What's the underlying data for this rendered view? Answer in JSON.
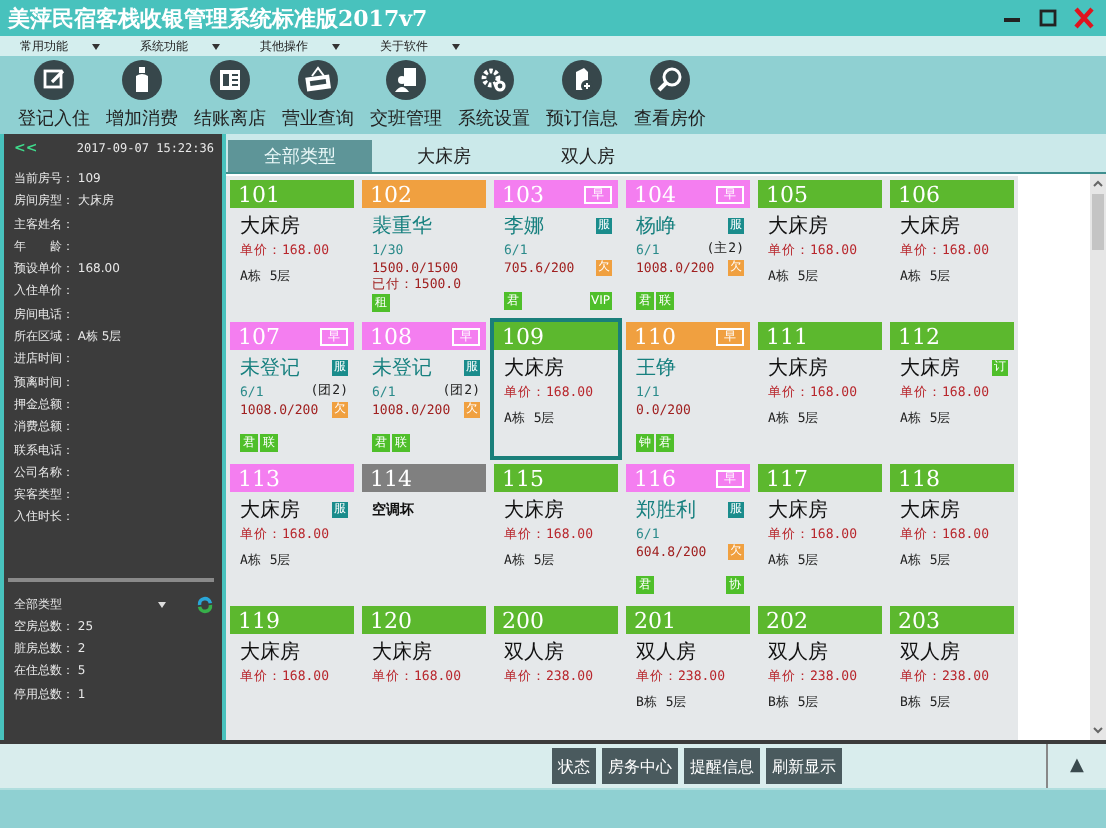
{
  "window": {
    "title": "美萍民宿客栈收银管理系统标准版2017v7"
  },
  "menu": [
    {
      "label": "常用功能"
    },
    {
      "label": "系统功能"
    },
    {
      "label": "其他操作"
    },
    {
      "label": "关于软件"
    }
  ],
  "toolbar": [
    {
      "label": "登记入住"
    },
    {
      "label": "增加消费"
    },
    {
      "label": "结账离店"
    },
    {
      "label": "营业查询"
    },
    {
      "label": "交班管理"
    },
    {
      "label": "系统设置"
    },
    {
      "label": "预订信息"
    },
    {
      "label": "查看房价"
    }
  ],
  "side": {
    "collapse": "<<",
    "clock": "2017-09-07 15:22:36",
    "fields": [
      {
        "label": "当前房号：",
        "value": "109"
      },
      {
        "label": "房间房型：",
        "value": "大床房"
      },
      {
        "label": "主客姓名："
      },
      {
        "label": "年　　龄："
      },
      {
        "label": "预设单价：",
        "value": "168.00"
      },
      {
        "label": "入住单价："
      },
      {
        "label": "房间电话："
      },
      {
        "label": "所在区域：",
        "value": "A栋 5层"
      },
      {
        "label": "进店时间："
      },
      {
        "label": "预离时间："
      },
      {
        "label": "押金总额："
      },
      {
        "label": "消费总额："
      },
      {
        "label": "联系电话："
      },
      {
        "label": "公司名称："
      },
      {
        "label": "宾客类型："
      },
      {
        "label": "入住时长："
      }
    ],
    "filter": "全部类型",
    "counts": [
      {
        "label": "空房总数：",
        "value": "25"
      },
      {
        "label": "脏房总数：",
        "value": "2"
      },
      {
        "label": "在住总数：",
        "value": "5"
      },
      {
        "label": "停用总数：",
        "value": "1"
      }
    ]
  },
  "tabs": [
    {
      "label": "全部类型",
      "selected": true
    },
    {
      "label": "大床房",
      "selected": false
    },
    {
      "label": "双人房",
      "selected": false
    }
  ],
  "rooms": [
    {
      "number": "101",
      "color": "#5cb82e",
      "selected": false,
      "title": {
        "text": "大床房",
        "kind": "room"
      },
      "lines": [
        {
          "text": "单价：168.00",
          "kind": "price"
        },
        {
          "text": "A栋 5层",
          "kind": "loc"
        }
      ]
    },
    {
      "number": "102",
      "color": "#f0a040",
      "selected": false,
      "title": {
        "text": "裴重华",
        "kind": "guest"
      },
      "lines": [
        {
          "text": "1/30",
          "kind": "count"
        },
        {
          "text": "1500.0/1500",
          "kind": "amount"
        },
        {
          "text": "已付：1500.0",
          "kind": "amount"
        }
      ],
      "tags": [
        "租"
      ]
    },
    {
      "number": "103",
      "color": "#f47ef0",
      "selected": false,
      "early": "早",
      "title": {
        "text": "李娜",
        "kind": "guest"
      },
      "flag": {
        "text": "服",
        "kind": "service"
      },
      "lines": [
        {
          "text": "6/1",
          "kind": "count"
        },
        {
          "text": "705.6/200",
          "kind": "amount",
          "flag": {
            "text": "欠",
            "kind": "owe"
          }
        }
      ],
      "tags": [
        "君"
      ],
      "end_tag": "VIP"
    },
    {
      "number": "104",
      "color": "#f47ef0",
      "selected": false,
      "early": "早",
      "title": {
        "text": "杨峥",
        "kind": "guest"
      },
      "flag": {
        "text": "服",
        "kind": "service"
      },
      "lines": [
        {
          "text": "6/1",
          "kind": "count",
          "note": "(主2)"
        },
        {
          "text": "1008.0/200",
          "kind": "amount",
          "flag": {
            "text": "欠",
            "kind": "owe"
          }
        }
      ],
      "tags": [
        "君",
        "联"
      ]
    },
    {
      "number": "105",
      "color": "#5cb82e",
      "selected": false,
      "title": {
        "text": "大床房",
        "kind": "room"
      },
      "lines": [
        {
          "text": "单价：168.00",
          "kind": "price"
        },
        {
          "text": "A栋 5层",
          "kind": "loc"
        }
      ]
    },
    {
      "number": "106",
      "color": "#5cb82e",
      "selected": false,
      "title": {
        "text": "大床房",
        "kind": "room"
      },
      "lines": [
        {
          "text": "单价：168.00",
          "kind": "price"
        },
        {
          "text": "A栋 5层",
          "kind": "loc"
        }
      ]
    },
    {
      "number": "107",
      "color": "#f47ef0",
      "selected": false,
      "early": "早",
      "title": {
        "text": "未登记",
        "kind": "guest"
      },
      "flag": {
        "text": "服",
        "kind": "service"
      },
      "lines": [
        {
          "text": "6/1",
          "kind": "count",
          "note": "(团2)"
        },
        {
          "text": "1008.0/200",
          "kind": "amount",
          "flag": {
            "text": "欠",
            "kind": "owe"
          }
        }
      ],
      "tags": [
        "君",
        "联"
      ]
    },
    {
      "number": "108",
      "color": "#f47ef0",
      "selected": false,
      "early": "早",
      "title": {
        "text": "未登记",
        "kind": "guest"
      },
      "flag": {
        "text": "服",
        "kind": "service"
      },
      "lines": [
        {
          "text": "6/1",
          "kind": "count",
          "note": "(团2)"
        },
        {
          "text": "1008.0/200",
          "kind": "amount",
          "flag": {
            "text": "欠",
            "kind": "owe"
          }
        }
      ],
      "tags": [
        "君",
        "联"
      ]
    },
    {
      "number": "109",
      "color": "#5cb82e",
      "selected": true,
      "title": {
        "text": "大床房",
        "kind": "room"
      },
      "lines": [
        {
          "text": "单价：168.00",
          "kind": "price"
        },
        {
          "text": "A栋 5层",
          "kind": "loc"
        }
      ]
    },
    {
      "number": "110",
      "color": "#f0a040",
      "selected": false,
      "early": "早",
      "title": {
        "text": "王铮",
        "kind": "guest"
      },
      "lines": [
        {
          "text": "1/1",
          "kind": "count"
        },
        {
          "text": "0.0/200",
          "kind": "amount"
        }
      ],
      "tags": [
        "钟",
        "君"
      ]
    },
    {
      "number": "111",
      "color": "#5cb82e",
      "selected": false,
      "title": {
        "text": "大床房",
        "kind": "room"
      },
      "lines": [
        {
          "text": "单价：168.00",
          "kind": "price"
        },
        {
          "text": "A栋 5层",
          "kind": "loc"
        }
      ]
    },
    {
      "number": "112",
      "color": "#5cb82e",
      "selected": false,
      "title": {
        "text": "大床房",
        "kind": "room"
      },
      "flag": {
        "text": "订",
        "kind": "book"
      },
      "lines": [
        {
          "text": "单价：168.00",
          "kind": "price"
        },
        {
          "text": "A栋 5层",
          "kind": "loc"
        }
      ]
    },
    {
      "number": "113",
      "color": "#f47ef0",
      "selected": false,
      "title": {
        "text": "大床房",
        "kind": "room"
      },
      "flag": {
        "text": "服",
        "kind": "service"
      },
      "lines": [
        {
          "text": "单价：168.00",
          "kind": "price"
        },
        {
          "text": "A栋 5层",
          "kind": "loc"
        }
      ]
    },
    {
      "number": "114",
      "color": "#808080",
      "selected": false,
      "title": {
        "text": "空调坏",
        "kind": "note"
      }
    },
    {
      "number": "115",
      "color": "#5cb82e",
      "selected": false,
      "title": {
        "text": "大床房",
        "kind": "room"
      },
      "lines": [
        {
          "text": "单价：168.00",
          "kind": "price"
        },
        {
          "text": "A栋 5层",
          "kind": "loc"
        }
      ]
    },
    {
      "number": "116",
      "color": "#f47ef0",
      "selected": false,
      "early": "早",
      "title": {
        "text": "郑胜利",
        "kind": "guest"
      },
      "flag": {
        "text": "服",
        "kind": "service"
      },
      "lines": [
        {
          "text": "6/1",
          "kind": "count"
        },
        {
          "text": "604.8/200",
          "kind": "amount",
          "flag": {
            "text": "欠",
            "kind": "owe"
          }
        }
      ],
      "tags": [
        "君"
      ],
      "end_tag": "协"
    },
    {
      "number": "117",
      "color": "#5cb82e",
      "selected": false,
      "title": {
        "text": "大床房",
        "kind": "room"
      },
      "lines": [
        {
          "text": "单价：168.00",
          "kind": "price"
        },
        {
          "text": "A栋 5层",
          "kind": "loc"
        }
      ]
    },
    {
      "number": "118",
      "color": "#5cb82e",
      "selected": false,
      "title": {
        "text": "大床房",
        "kind": "room"
      },
      "lines": [
        {
          "text": "单价：168.00",
          "kind": "price"
        },
        {
          "text": "A栋 5层",
          "kind": "loc"
        }
      ]
    },
    {
      "number": "119",
      "color": "#5cb82e",
      "selected": false,
      "title": {
        "text": "大床房",
        "kind": "room"
      },
      "lines": [
        {
          "text": "单价：168.00",
          "kind": "price"
        }
      ]
    },
    {
      "number": "120",
      "color": "#5cb82e",
      "selected": false,
      "title": {
        "text": "大床房",
        "kind": "room"
      },
      "lines": [
        {
          "text": "单价：168.00",
          "kind": "price"
        }
      ]
    },
    {
      "number": "200",
      "color": "#5cb82e",
      "selected": false,
      "title": {
        "text": "双人房",
        "kind": "room"
      },
      "lines": [
        {
          "text": "单价：238.00",
          "kind": "price"
        }
      ]
    },
    {
      "number": "201",
      "color": "#5cb82e",
      "selected": false,
      "title": {
        "text": "双人房",
        "kind": "room"
      },
      "lines": [
        {
          "text": "单价：238.00",
          "kind": "price"
        },
        {
          "text": "B栋 5层",
          "kind": "loc"
        }
      ]
    },
    {
      "number": "202",
      "color": "#5cb82e",
      "selected": false,
      "title": {
        "text": "双人房",
        "kind": "room"
      },
      "lines": [
        {
          "text": "单价：238.00",
          "kind": "price"
        },
        {
          "text": "B栋 5层",
          "kind": "loc"
        }
      ]
    },
    {
      "number": "203",
      "color": "#5cb82e",
      "selected": false,
      "title": {
        "text": "双人房",
        "kind": "room"
      },
      "lines": [
        {
          "text": "单价：238.00",
          "kind": "price"
        },
        {
          "text": "B栋 5层",
          "kind": "loc"
        }
      ]
    }
  ],
  "bottom_buttons": [
    {
      "label": "状态"
    },
    {
      "label": "房务中心"
    },
    {
      "label": "提醒信息"
    },
    {
      "label": "刷新显示"
    }
  ],
  "collapse_button": "▲"
}
